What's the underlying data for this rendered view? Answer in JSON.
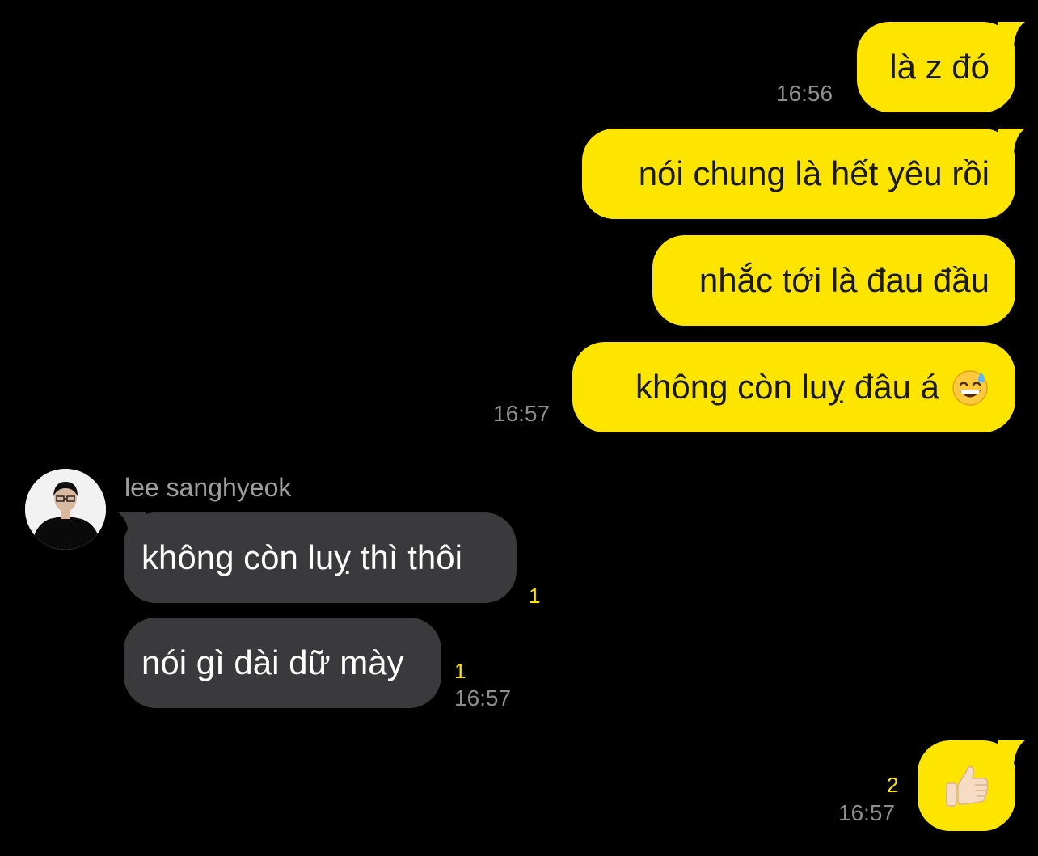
{
  "chat": {
    "outgoing_1": {
      "text": "là z đó",
      "time": "16:56"
    },
    "outgoing_2": {
      "text": "nói chung là hết yêu rồi"
    },
    "outgoing_3": {
      "text": "nhắc tới là đau đầu"
    },
    "outgoing_4": {
      "text": "không còn luỵ đâu á",
      "emoji": "grinning-sweat-emoji",
      "time": "16:57"
    },
    "incoming": {
      "sender_name": "lee sanghyeok",
      "avatar_icon": "profile-avatar",
      "messages": [
        {
          "text": "không còn luỵ thì thôi",
          "unread": "1"
        },
        {
          "text": "nói gì dài dữ mày",
          "unread": "1",
          "time": "16:57"
        }
      ]
    },
    "outgoing_5": {
      "emoji": "thumbs-up-emoji",
      "unread": "2",
      "time": "16:57"
    }
  },
  "colors": {
    "background": "#000000",
    "outgoing_bubble": "#FEE500",
    "incoming_bubble": "#3A3A3C",
    "timestamp": "#8E8E8E",
    "unread_count": "#FEE500"
  }
}
